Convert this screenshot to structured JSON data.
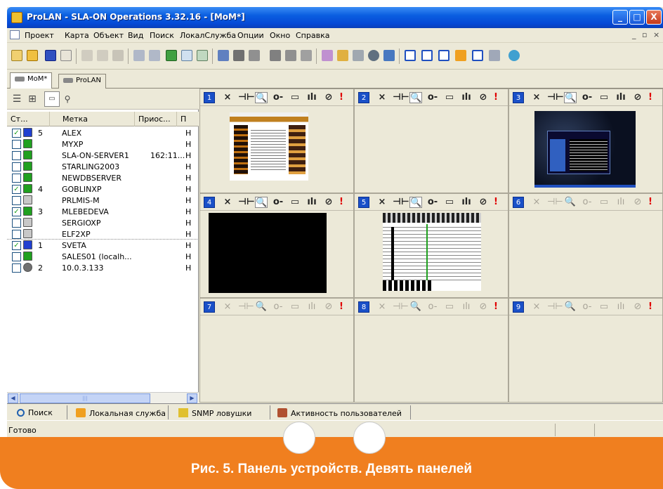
{
  "window": {
    "title": "ProLAN - SLA-ON Operations 3.32.16 - [MoM*]",
    "controls": [
      "_",
      "□",
      "X"
    ]
  },
  "menu": {
    "items": [
      "Проект",
      "Карта",
      "Объект",
      "Вид",
      "Поиск",
      "ЛокалСлужба",
      "Опции",
      "Окно",
      "Справка"
    ],
    "mdi_controls": [
      "_",
      "▫",
      "×"
    ]
  },
  "doc_tabs": [
    "MoM*",
    "ProLAN"
  ],
  "device_list": {
    "columns": [
      "Ст...",
      "Метка",
      "Приос...",
      "П"
    ],
    "rows": [
      {
        "checked": true,
        "status": "blue",
        "num": "5",
        "name": "ALEX",
        "ip": "",
        "state": "Н"
      },
      {
        "checked": false,
        "status": "green",
        "num": "",
        "name": "MYXP",
        "ip": "",
        "state": "Н"
      },
      {
        "checked": false,
        "status": "green",
        "num": "",
        "name": "SLA-ON-SERVER1",
        "ip": "162:11...",
        "state": "Н"
      },
      {
        "checked": false,
        "status": "green",
        "num": "",
        "name": "STARLING2003",
        "ip": "",
        "state": "Н"
      },
      {
        "checked": false,
        "status": "green",
        "num": "",
        "name": "NEWDBSERVER",
        "ip": "",
        "state": "Н"
      },
      {
        "checked": true,
        "status": "green",
        "num": "4",
        "name": "GOBLINXP",
        "ip": "",
        "state": "Н"
      },
      {
        "checked": false,
        "status": "gray",
        "num": "",
        "name": "PRLMIS-M",
        "ip": "",
        "state": "Н"
      },
      {
        "checked": true,
        "status": "green",
        "num": "3",
        "name": "MLEBEDEVA",
        "ip": "",
        "state": "Н"
      },
      {
        "checked": false,
        "status": "gray",
        "num": "",
        "name": "SERGIOXP",
        "ip": "",
        "state": "Н"
      },
      {
        "checked": false,
        "status": "gray",
        "num": "",
        "name": "ELF2XP",
        "ip": "",
        "state": "Н"
      },
      {
        "checked": true,
        "status": "blue",
        "num": "1",
        "name": "SVETA",
        "ip": "",
        "state": "Н"
      },
      {
        "checked": false,
        "status": "green",
        "num": "",
        "name": "SALES01 (localh...",
        "ip": "",
        "state": "Н"
      },
      {
        "checked": false,
        "status": "disk",
        "num": "2",
        "name": "10.0.3.133",
        "ip": "",
        "state": "Н"
      }
    ]
  },
  "panels": [
    {
      "num": "1",
      "active": true,
      "content": "web"
    },
    {
      "num": "2",
      "active": true,
      "content": "empty"
    },
    {
      "num": "3",
      "active": true,
      "content": "dark-desktop"
    },
    {
      "num": "4",
      "active": true,
      "content": "black"
    },
    {
      "num": "5",
      "active": true,
      "content": "spreadsheet"
    },
    {
      "num": "6",
      "active": false,
      "content": "empty"
    },
    {
      "num": "7",
      "active": false,
      "content": "empty"
    },
    {
      "num": "8",
      "active": false,
      "content": "empty"
    },
    {
      "num": "9",
      "active": false,
      "content": "empty"
    }
  ],
  "panel_toolbar": {
    "close": "×",
    "pin": "⊣⊢",
    "zoom": "🔍",
    "key": "o-",
    "screen": "▭",
    "chart": "ılı",
    "refresh": "⊘",
    "alert": "!"
  },
  "bottom_tabs": [
    "Поиск",
    "Локальная служба",
    "SNMP ловушки",
    "Активность пользователей"
  ],
  "status_text": "Готово",
  "caption": "Рис. 5. Панель устройств. Девять панелей",
  "colors": {
    "accent": "#f07f1f",
    "title_blue": "#0a5ee0",
    "panel_num": "#1a50c8",
    "alert": "#e00000"
  }
}
